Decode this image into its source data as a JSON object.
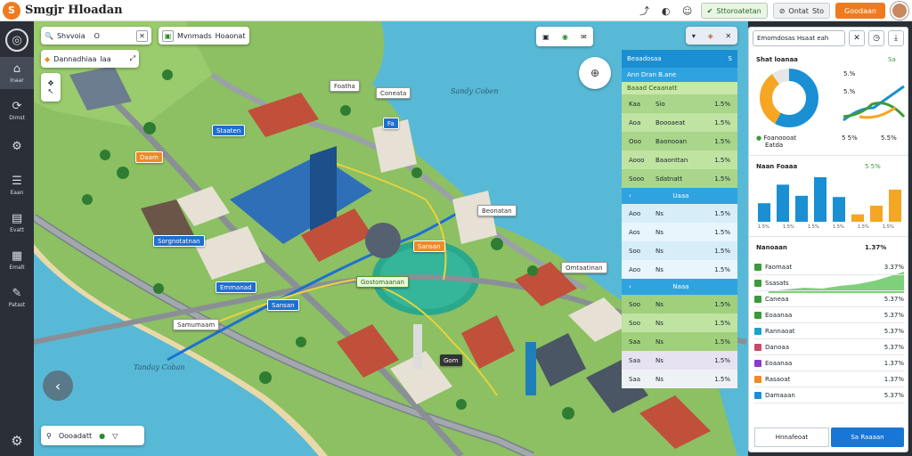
{
  "app": {
    "title": "Smgjr Hloadan",
    "logo": "S"
  },
  "topbar": {
    "icons": [
      "share-icon",
      "compass-icon",
      "chat-icon"
    ],
    "pill_green": "Sttoroatetan",
    "pill_gray": "Ontat",
    "pill_gray_value": "Sto",
    "orange_button": "Goodaan"
  },
  "rail": [
    {
      "icon": "⌂",
      "label": "Inaar",
      "active": true
    },
    {
      "icon": "⟳",
      "label": "Dimst"
    },
    {
      "icon": "⚙",
      "label": ""
    },
    {
      "icon": "☰",
      "label": "Eaan"
    },
    {
      "icon": "▤",
      "label": "Evatt"
    },
    {
      "icon": "▦",
      "label": "Emalt"
    },
    {
      "icon": "✎",
      "label": "Patast"
    }
  ],
  "map": {
    "search": {
      "label": "Shvvoia",
      "value": "O"
    },
    "filter": {
      "label": "Mvnmads",
      "value": "Hoaonat"
    },
    "layer": {
      "label": "Dannadhiaa",
      "value": "Iaa"
    },
    "labels": [
      "Sandy Coben",
      "Tanday Coban"
    ],
    "markers": [
      {
        "text": "Daam",
        "style": "orange"
      },
      {
        "text": "Foatha",
        "style": "white"
      },
      {
        "text": "Coneata",
        "style": "white"
      },
      {
        "text": "Staaten",
        "style": "blue"
      },
      {
        "text": "Emmanad",
        "style": "blue"
      },
      {
        "text": "Beonatan",
        "style": "white"
      },
      {
        "text": "Sorgnotatnan",
        "style": "blue"
      },
      {
        "text": "Sansan",
        "style": "blue"
      },
      {
        "text": "Sansan",
        "style": "orange"
      },
      {
        "text": "Gostomaanan",
        "style": "green"
      },
      {
        "text": "Samumaam",
        "style": "white"
      },
      {
        "text": "Omtaatinan",
        "style": "white"
      },
      {
        "text": "Gom",
        "style": "dark"
      },
      {
        "text": "Fa",
        "style": "blue"
      }
    ],
    "bottom_bar": {
      "label": "Oooadatt"
    }
  },
  "stats_panel": {
    "header": {
      "title": "Beaadosaa",
      "value": "S"
    },
    "subheader": "Ann Dran B.ane",
    "green_header": "Baaad Ceaanatt",
    "rows_a": [
      {
        "k": "Kaa",
        "m": "Sio",
        "v": "1.5%"
      },
      {
        "k": "Aoa",
        "m": "Boooaeat",
        "v": "1.5%"
      },
      {
        "k": "Ooo",
        "m": "Baonooan",
        "v": "1.5%"
      },
      {
        "k": "Aooo",
        "m": "Baaonttan",
        "v": "1.5%"
      },
      {
        "k": "Sooo",
        "m": "Sdatnatt",
        "v": "1.5%"
      }
    ],
    "section_a": "Uaaa",
    "rows_b": [
      {
        "k": "Aoo",
        "m": "Ns",
        "v": "1.5%"
      },
      {
        "k": "Aos",
        "m": "Ns",
        "v": "1.5%"
      },
      {
        "k": "Soo",
        "m": "Ns",
        "v": "1.5%"
      },
      {
        "k": "Aoo",
        "m": "Ns",
        "v": "1.5%"
      }
    ],
    "section_b": "Naaa",
    "rows_c": [
      {
        "k": "Soo",
        "m": "Ns",
        "v": "1.5%"
      },
      {
        "k": "Soo",
        "m": "Ns",
        "v": "1.5%"
      },
      {
        "k": "Saa",
        "m": "Ns",
        "v": "1.5%"
      },
      {
        "k": "Saa",
        "m": "Ns",
        "v": "1.5%"
      },
      {
        "k": "Saa",
        "m": "Ns",
        "v": "1.5%"
      }
    ]
  },
  "right_panel": {
    "tab": "Emomdosas Hsaat eah",
    "section1": {
      "title": "Shat loanaa",
      "badge": "Sa"
    },
    "donut": {
      "values": [
        58,
        32,
        10
      ],
      "colors": [
        "#1a8fd3",
        "#f5a623",
        "#e6e6e6"
      ]
    },
    "donut_legend": [
      "5.%",
      "5.%"
    ],
    "legend_a": {
      "label": "Foanoooat",
      "sub": "Eatda"
    },
    "legend_vals": [
      "5 5%",
      "5.5%"
    ],
    "section2": {
      "title": "Naan Foaaa",
      "badge": "5 5%"
    },
    "bars": {
      "values": [
        30,
        60,
        42,
        72,
        40,
        12,
        26,
        52
      ],
      "colors": [
        "#1a8fd3",
        "#1a8fd3",
        "#1a8fd3",
        "#1a8fd3",
        "#1a8fd3",
        "#f5a623",
        "#f5a623",
        "#f5a623"
      ],
      "small": [
        "1.5%",
        "1.5%",
        "1.5%",
        "1.5%",
        "1.5%",
        "1.5%"
      ]
    },
    "section3": {
      "title": "Nanoaan",
      "value": "1.37%"
    },
    "list": [
      {
        "label": "Faomaat",
        "value": "3.37%",
        "color": "#3d9a3a"
      },
      {
        "label": "Ssasats",
        "value": "",
        "color": "#3d9a3a"
      },
      {
        "label": "Caneaa",
        "value": "5.37%",
        "color": "#3d9a3a"
      },
      {
        "label": "Eoaanaa",
        "value": "5.37%",
        "color": "#3d9a3a"
      },
      {
        "label": "Rannaoat",
        "value": "5.37%",
        "color": "#1aa3c9"
      },
      {
        "label": "Danoaa",
        "value": "5.37%",
        "color": "#c94b6b"
      },
      {
        "label": "Eoaanaa",
        "value": "1.37%",
        "color": "#8a3ac9"
      },
      {
        "label": "Rasaoat",
        "value": "1.37%",
        "color": "#f08a22"
      },
      {
        "label": "Damaaan",
        "value": "5.37%",
        "color": "#1a8fd3"
      }
    ],
    "btn_secondary": "Hnnafeoat",
    "btn_primary": "Sa Raaaan"
  }
}
